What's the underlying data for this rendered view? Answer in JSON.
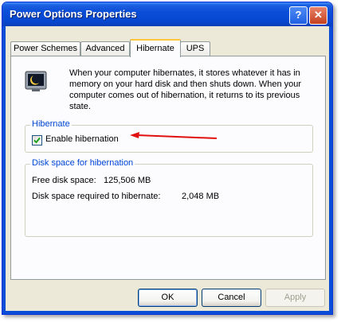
{
  "window": {
    "title": "Power Options Properties"
  },
  "titlebar_buttons": {
    "help": "?",
    "close": "✕"
  },
  "tabs": [
    {
      "label": "Power Schemes"
    },
    {
      "label": "Advanced"
    },
    {
      "label": "Hibernate"
    },
    {
      "label": "UPS"
    }
  ],
  "active_tab": "Hibernate",
  "description": "When your computer hibernates, it stores whatever it has in memory on your hard disk and then shuts down. When your computer comes out of hibernation, it returns to its previous state.",
  "hibernate_group": {
    "title": "Hibernate",
    "checkbox_label": "Enable hibernation",
    "checked": true
  },
  "disk_group": {
    "title": "Disk space for hibernation",
    "free_label": "Free disk space:",
    "free_value": "125,506 MB",
    "required_label": "Disk space required to hibernate:",
    "required_value": "2,048 MB"
  },
  "buttons": {
    "ok": "OK",
    "cancel": "Cancel",
    "apply": "Apply"
  },
  "colors": {
    "titlebar": "#0a4ed8",
    "group_title": "#0046d5",
    "arrow": "#e01010",
    "active_tab_accent": "#ffc83c"
  },
  "icons": [
    "monitor-moon-icon",
    "red-arrow-icon",
    "checkmark-icon"
  ]
}
